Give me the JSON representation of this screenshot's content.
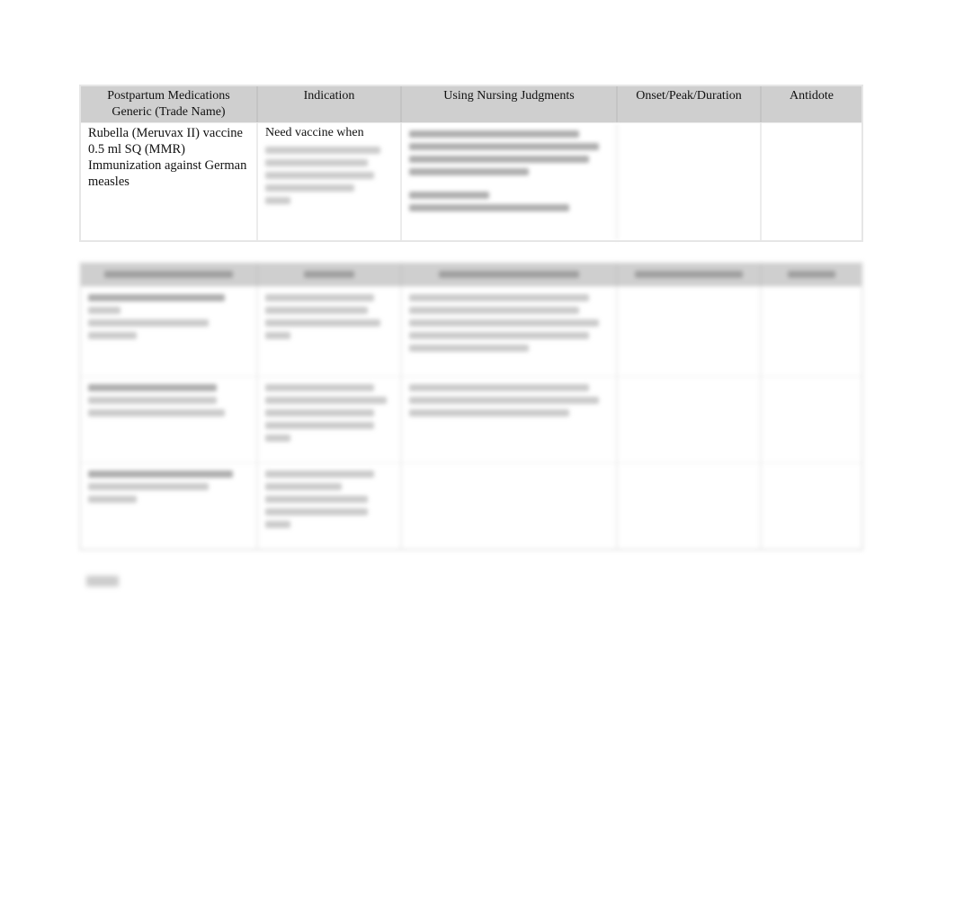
{
  "table1": {
    "headers": [
      "Postpartum Medications Generic (Trade Name)",
      "Indication",
      "Using Nursing Judgments",
      "Onset/Peak/Duration",
      "Antidote"
    ],
    "rows": [
      {
        "medication": "Rubella (Meruvax II) vaccine 0.5 ml SQ (MMR) Immunization against German measles",
        "indication": "Need vaccine when",
        "nursing": "",
        "onset": "",
        "antidote": ""
      }
    ]
  }
}
